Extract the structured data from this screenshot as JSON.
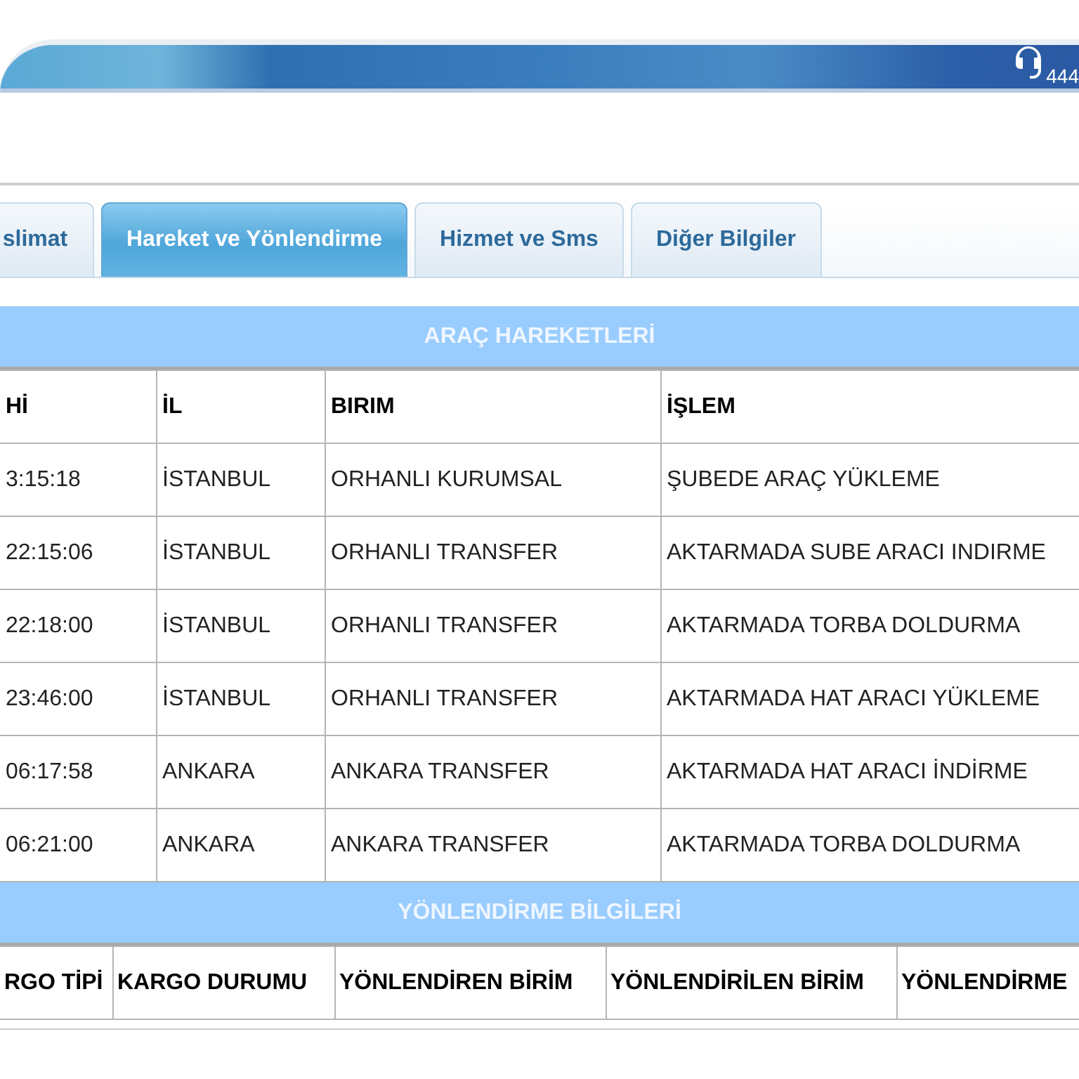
{
  "banner": {
    "phone_text": "444"
  },
  "tabs": [
    {
      "label": "slimat",
      "selected": false
    },
    {
      "label": "Hareket ve Yönlendirme",
      "selected": true
    },
    {
      "label": "Hizmet ve Sms",
      "selected": false
    },
    {
      "label": "Diğer Bilgiler",
      "selected": false
    }
  ],
  "vehicle_movements": {
    "title": "ARAÇ HAREKETLERİ",
    "columns": [
      "Hİ",
      "İL",
      "BIRIM",
      "İŞLEM"
    ],
    "rows": [
      [
        "3:15:18",
        "İSTANBUL",
        "ORHANLI KURUMSAL",
        "ŞUBEDE ARAÇ YÜKLEME"
      ],
      [
        "22:15:06",
        "İSTANBUL",
        "ORHANLI TRANSFER",
        "AKTARMADA SUBE ARACI INDIRME"
      ],
      [
        "22:18:00",
        "İSTANBUL",
        "ORHANLI TRANSFER",
        "AKTARMADA TORBA DOLDURMA"
      ],
      [
        "23:46:00",
        "İSTANBUL",
        "ORHANLI TRANSFER",
        "AKTARMADA HAT ARACI YÜKLEME"
      ],
      [
        "06:17:58",
        "ANKARA",
        "ANKARA TRANSFER",
        "AKTARMADA HAT ARACI İNDİRME"
      ],
      [
        "06:21:00",
        "ANKARA",
        "ANKARA TRANSFER",
        "AKTARMADA TORBA DOLDURMA"
      ]
    ]
  },
  "routing": {
    "title": "YÖNLENDİRME BİLGİLERİ",
    "columns": [
      "RGO TİPİ",
      "KARGO DURUMU",
      "YÖNLENDİREN BİRİM",
      "YÖNLENDİRİLEN BİRİM",
      "YÖNLENDİRME"
    ]
  }
}
